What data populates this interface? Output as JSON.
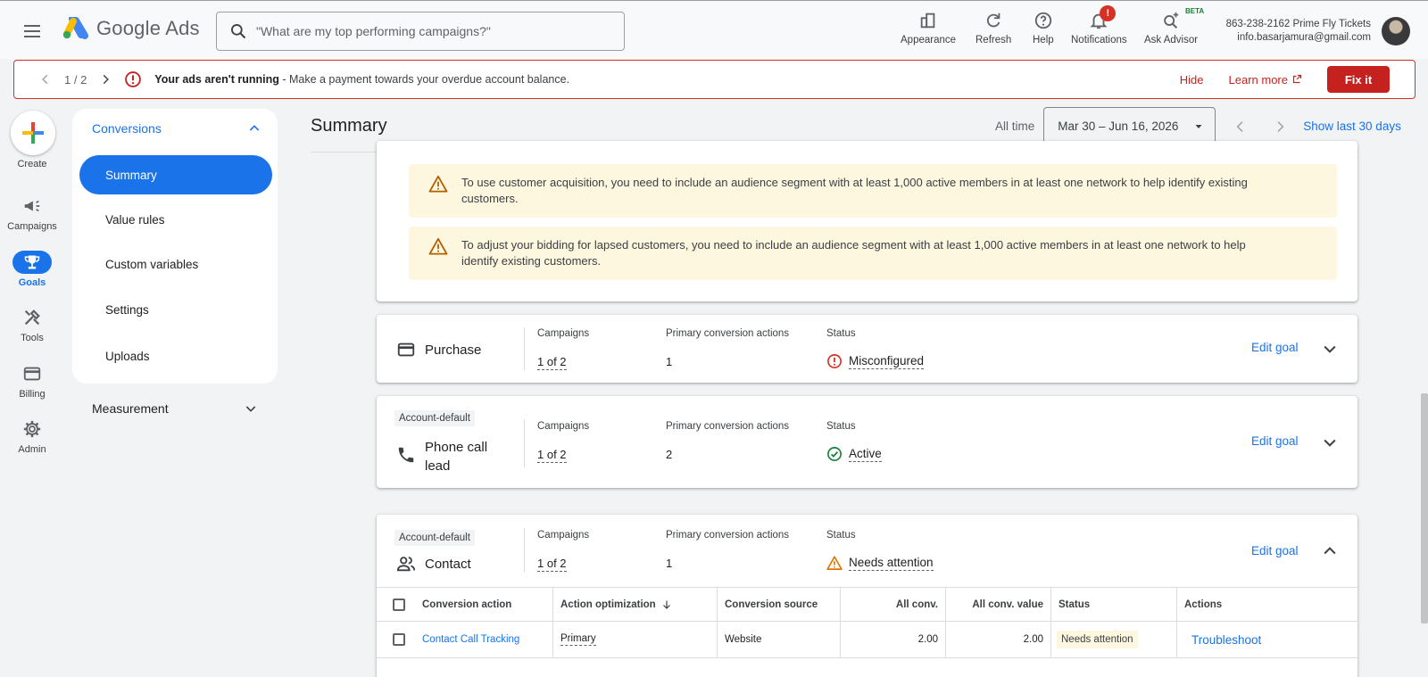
{
  "header": {
    "app_name": "Google Ads",
    "search_placeholder": "\"What are my top performing campaigns?\"",
    "tools": [
      {
        "label": "Appearance",
        "icon": "appearance-icon"
      },
      {
        "label": "Refresh",
        "icon": "refresh-icon"
      },
      {
        "label": "Help",
        "icon": "help-icon"
      },
      {
        "label": "Notifications",
        "icon": "bell-icon",
        "badge": "!"
      },
      {
        "label": "Ask Advisor",
        "icon": "advisor-icon",
        "tag": "BETA"
      }
    ],
    "account_line1": "863-238-2162 Prime Fly Tickets",
    "account_line2": "info.basarjamura@gmail.com"
  },
  "alert": {
    "pager": "1 / 2",
    "title": "Your ads aren't running",
    "message": " - Make a payment towards your overdue account balance.",
    "hide": "Hide",
    "learn_more": "Learn more",
    "fix": "Fix it"
  },
  "rail": {
    "create": "Create",
    "items": [
      {
        "label": "Campaigns",
        "icon": "megaphone-icon"
      },
      {
        "label": "Goals",
        "icon": "trophy-icon",
        "active": true
      },
      {
        "label": "Tools",
        "icon": "tools-icon"
      },
      {
        "label": "Billing",
        "icon": "credit-card-icon"
      },
      {
        "label": "Admin",
        "icon": "gear-icon"
      }
    ]
  },
  "subnav": {
    "section": "Conversions",
    "items": [
      "Summary",
      "Value rules",
      "Custom variables",
      "Settings",
      "Uploads"
    ],
    "active": "Summary",
    "measurement": "Measurement"
  },
  "summary": {
    "title": "Summary",
    "range_label": "All time",
    "date_range": "Mar 30 – Jun 16, 2026",
    "show_last": "Show last 30 days"
  },
  "warnings": [
    "To use customer acquisition, you need to include an audience segment with at least 1,000 active members in at least one network to help identify existing customers.",
    "To adjust your bidding for lapsed customers, you need to include an audience segment with at least 1,000 active members in at least one network to help identify existing customers."
  ],
  "col_labels": {
    "campaigns": "Campaigns",
    "primary": "Primary conversion actions",
    "status": "Status"
  },
  "edit_goal": "Edit goal",
  "goals": [
    {
      "name": "Purchase",
      "badge": "",
      "campaigns": "1 of 2",
      "primary": "1",
      "status": "Misconfigured",
      "status_color": "#d93025",
      "icon": "credit-card-icon"
    },
    {
      "name": "Phone call lead",
      "name_line1": "Phone call",
      "name_line2": "lead",
      "badge": "Account-default",
      "campaigns": "1 of 2",
      "primary": "2",
      "status": "Active",
      "status_color": "#188038",
      "icon": "phone-icon"
    },
    {
      "name": "Contact",
      "badge": "Account-default",
      "campaigns": "1 of 2",
      "primary": "1",
      "status": "Needs attention",
      "status_color": "#e37400",
      "icon": "contacts-icon"
    }
  ],
  "table": {
    "headers": [
      "Conversion action",
      "Action optimization",
      "Conversion source",
      "All conv.",
      "All conv. value",
      "Status",
      "Actions"
    ],
    "rows": [
      {
        "action": "Contact Call Tracking",
        "optimization": "Primary",
        "source": "Website",
        "all_conv": "2.00",
        "all_conv_value": "2.00",
        "status": "Needs attention",
        "actions": "Troubleshoot"
      }
    ]
  }
}
